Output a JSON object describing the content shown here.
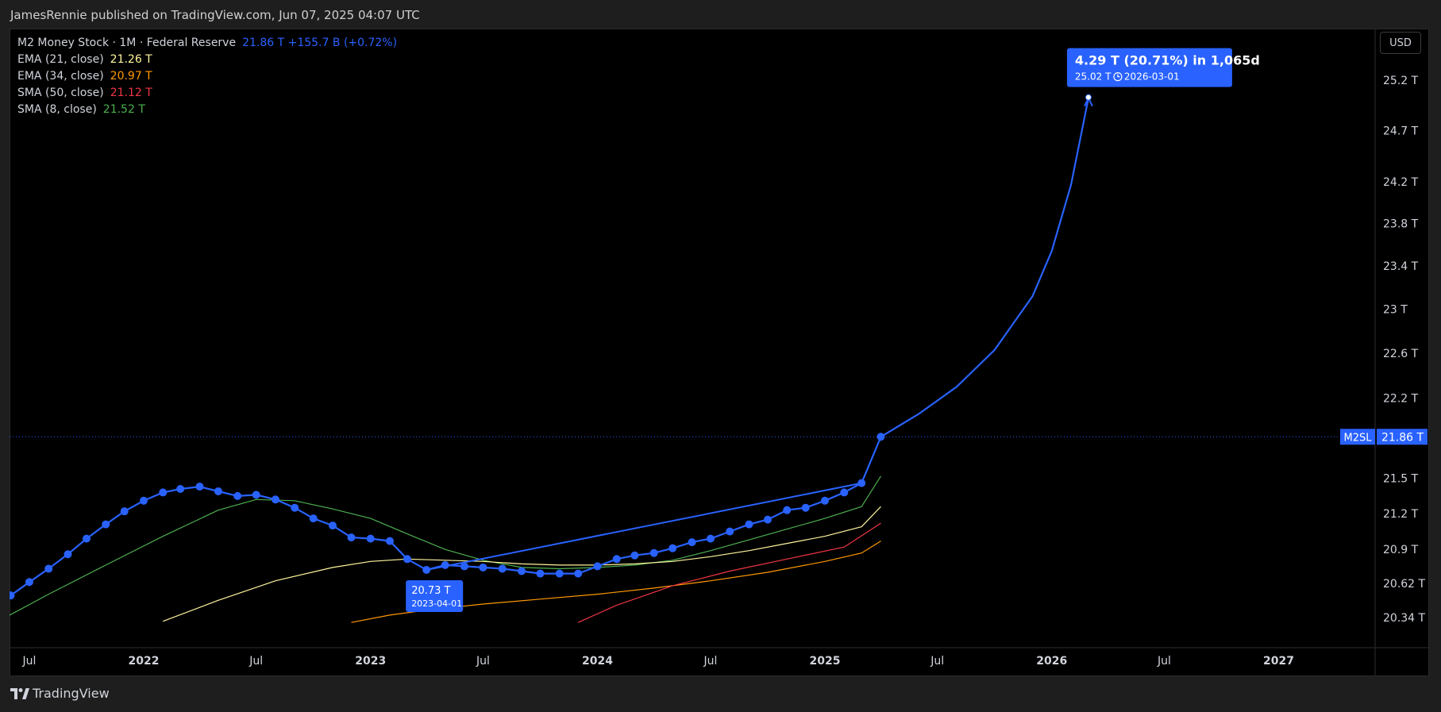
{
  "header": {
    "published": "JamesRennie published on TradingView.com, Jun 07, 2025 04:07 UTC"
  },
  "legend": [
    {
      "name": "M2 Money Stock · 1M · Federal Reserve",
      "value": "21.86 T  +155.7 B  (+0.72%)",
      "color": "#2962ff"
    },
    {
      "name": "EMA (21, close)",
      "value": "21.26 T",
      "color": "#fff59d"
    },
    {
      "name": "EMA (34, close)",
      "value": "20.97 T",
      "color": "#ff9800"
    },
    {
      "name": "SMA (50, close)",
      "value": "21.12 T",
      "color": "#f23645"
    },
    {
      "name": "SMA (8, close)",
      "value": "21.52 T",
      "color": "#4caf50"
    }
  ],
  "currency_button": "USD",
  "footer": {
    "brand": "TradingView"
  },
  "chart_data": {
    "type": "line",
    "y_scale": "log",
    "y_ticks": [
      {
        "value": 25.2,
        "label": "25.2 T"
      },
      {
        "value": 24.7,
        "label": "24.7 T"
      },
      {
        "value": 24.2,
        "label": "24.2 T"
      },
      {
        "value": 23.8,
        "label": "23.8 T"
      },
      {
        "value": 23.4,
        "label": "23.4 T"
      },
      {
        "value": 23.0,
        "label": "23 T"
      },
      {
        "value": 22.6,
        "label": "22.6 T"
      },
      {
        "value": 22.2,
        "label": "22.2 T"
      },
      {
        "value": 21.5,
        "label": "21.5 T"
      },
      {
        "value": 21.2,
        "label": "21.2 T"
      },
      {
        "value": 20.9,
        "label": "20.9 T"
      },
      {
        "value": 20.62,
        "label": "20.62 T"
      },
      {
        "value": 20.34,
        "label": "20.34 T"
      }
    ],
    "x_ticks": [
      {
        "date": "2021-07-01",
        "label": "Jul",
        "bold": false
      },
      {
        "date": "2022-01-01",
        "label": "2022",
        "bold": true
      },
      {
        "date": "2022-07-01",
        "label": "Jul",
        "bold": false
      },
      {
        "date": "2023-01-01",
        "label": "2023",
        "bold": true
      },
      {
        "date": "2023-07-01",
        "label": "Jul",
        "bold": false
      },
      {
        "date": "2024-01-01",
        "label": "2024",
        "bold": true
      },
      {
        "date": "2024-07-01",
        "label": "Jul",
        "bold": false
      },
      {
        "date": "2025-01-01",
        "label": "2025",
        "bold": true
      },
      {
        "date": "2025-07-01",
        "label": "Jul",
        "bold": false
      },
      {
        "date": "2026-01-01",
        "label": "2026",
        "bold": true
      },
      {
        "date": "2026-07-01",
        "label": "Jul",
        "bold": false
      },
      {
        "date": "2027-01-01",
        "label": "2027",
        "bold": true
      }
    ],
    "price_marker": {
      "symbol": "M2SL",
      "value": 21.86,
      "label": "21.86 T"
    },
    "series": [
      {
        "name": "M2 Money Stock",
        "color": "#2962ff",
        "markers": true,
        "points": [
          [
            "2021-05-01",
            20.42
          ],
          [
            "2021-06-01",
            20.52
          ],
          [
            "2021-07-01",
            20.63
          ],
          [
            "2021-08-01",
            20.74
          ],
          [
            "2021-09-01",
            20.86
          ],
          [
            "2021-10-01",
            20.99
          ],
          [
            "2021-11-01",
            21.11
          ],
          [
            "2021-12-01",
            21.22
          ],
          [
            "2022-01-01",
            21.31
          ],
          [
            "2022-02-01",
            21.38
          ],
          [
            "2022-03-01",
            21.41
          ],
          [
            "2022-04-01",
            21.43
          ],
          [
            "2022-05-01",
            21.39
          ],
          [
            "2022-06-01",
            21.35
          ],
          [
            "2022-07-01",
            21.36
          ],
          [
            "2022-08-01",
            21.32
          ],
          [
            "2022-09-01",
            21.25
          ],
          [
            "2022-10-01",
            21.16
          ],
          [
            "2022-11-01",
            21.1
          ],
          [
            "2022-12-01",
            21.0
          ],
          [
            "2023-01-01",
            20.99
          ],
          [
            "2023-02-01",
            20.97
          ],
          [
            "2023-03-01",
            20.82
          ],
          [
            "2023-04-01",
            20.73
          ],
          [
            "2023-05-01",
            20.77
          ],
          [
            "2023-06-01",
            20.76
          ],
          [
            "2023-07-01",
            20.75
          ],
          [
            "2023-08-01",
            20.74
          ],
          [
            "2023-09-01",
            20.72
          ],
          [
            "2023-10-01",
            20.7
          ],
          [
            "2023-11-01",
            20.7
          ],
          [
            "2023-12-01",
            20.7
          ],
          [
            "2024-01-01",
            20.76
          ],
          [
            "2024-02-01",
            20.82
          ],
          [
            "2024-03-01",
            20.85
          ],
          [
            "2024-04-01",
            20.87
          ],
          [
            "2024-05-01",
            20.91
          ],
          [
            "2024-06-01",
            20.96
          ],
          [
            "2024-07-01",
            20.99
          ],
          [
            "2024-08-01",
            21.05
          ],
          [
            "2024-09-01",
            21.11
          ],
          [
            "2024-10-01",
            21.15
          ],
          [
            "2024-11-01",
            21.23
          ],
          [
            "2024-12-01",
            21.25
          ],
          [
            "2025-01-01",
            21.31
          ],
          [
            "2025-02-01",
            21.38
          ],
          [
            "2025-03-01",
            21.46
          ],
          [
            "2025-04-01",
            21.86
          ]
        ]
      },
      {
        "name": "SMA (8, close)",
        "color": "#4caf50",
        "points": [
          [
            "2021-05-01",
            20.28
          ],
          [
            "2021-08-01",
            20.53
          ],
          [
            "2021-11-01",
            20.77
          ],
          [
            "2022-02-01",
            21.01
          ],
          [
            "2022-05-01",
            21.23
          ],
          [
            "2022-07-01",
            21.32
          ],
          [
            "2022-09-01",
            21.31
          ],
          [
            "2022-11-01",
            21.24
          ],
          [
            "2023-01-01",
            21.16
          ],
          [
            "2023-03-01",
            21.03
          ],
          [
            "2023-05-01",
            20.9
          ],
          [
            "2023-07-01",
            20.81
          ],
          [
            "2023-09-01",
            20.75
          ],
          [
            "2023-11-01",
            20.74
          ],
          [
            "2024-01-01",
            20.75
          ],
          [
            "2024-03-01",
            20.77
          ],
          [
            "2024-05-01",
            20.81
          ],
          [
            "2024-07-01",
            20.89
          ],
          [
            "2024-09-01",
            20.98
          ],
          [
            "2024-11-01",
            21.07
          ],
          [
            "2025-01-01",
            21.16
          ],
          [
            "2025-03-01",
            21.26
          ],
          [
            "2025-04-01",
            21.52
          ]
        ]
      },
      {
        "name": "EMA (21, close)",
        "color": "#fff59d",
        "points": [
          [
            "2022-02-01",
            20.31
          ],
          [
            "2022-05-01",
            20.48
          ],
          [
            "2022-08-01",
            20.64
          ],
          [
            "2022-11-01",
            20.75
          ],
          [
            "2023-01-01",
            20.8
          ],
          [
            "2023-03-01",
            20.82
          ],
          [
            "2023-05-01",
            20.81
          ],
          [
            "2023-07-01",
            20.8
          ],
          [
            "2023-09-01",
            20.78
          ],
          [
            "2023-11-01",
            20.77
          ],
          [
            "2024-01-01",
            20.77
          ],
          [
            "2024-03-01",
            20.78
          ],
          [
            "2024-05-01",
            20.8
          ],
          [
            "2024-07-01",
            20.84
          ],
          [
            "2024-09-01",
            20.89
          ],
          [
            "2024-11-01",
            20.95
          ],
          [
            "2025-01-01",
            21.01
          ],
          [
            "2025-03-01",
            21.09
          ],
          [
            "2025-04-01",
            21.26
          ]
        ]
      },
      {
        "name": "EMA (34, close)",
        "color": "#ff9800",
        "points": [
          [
            "2022-12-01",
            20.3
          ],
          [
            "2023-02-01",
            20.36
          ],
          [
            "2023-04-01",
            20.4
          ],
          [
            "2023-07-01",
            20.45
          ],
          [
            "2023-10-01",
            20.49
          ],
          [
            "2024-01-01",
            20.53
          ],
          [
            "2024-04-01",
            20.58
          ],
          [
            "2024-07-01",
            20.64
          ],
          [
            "2024-10-01",
            20.71
          ],
          [
            "2025-01-01",
            20.8
          ],
          [
            "2025-03-01",
            20.87
          ],
          [
            "2025-04-01",
            20.97
          ]
        ]
      },
      {
        "name": "SMA (50, close)",
        "color": "#f23645",
        "points": [
          [
            "2023-12-01",
            20.3
          ],
          [
            "2024-02-01",
            20.44
          ],
          [
            "2024-05-01",
            20.6
          ],
          [
            "2024-08-01",
            20.72
          ],
          [
            "2024-11-01",
            20.82
          ],
          [
            "2025-02-01",
            20.92
          ],
          [
            "2025-04-01",
            21.12
          ]
        ]
      }
    ],
    "projection": {
      "color": "#2962ff",
      "points": [
        [
          "2025-04-01",
          21.86
        ],
        [
          "2025-06-01",
          22.06
        ],
        [
          "2025-08-01",
          22.3
        ],
        [
          "2025-10-01",
          22.63
        ],
        [
          "2025-12-01",
          23.12
        ],
        [
          "2026-01-01",
          23.54
        ],
        [
          "2026-02-01",
          24.17
        ],
        [
          "2026-03-01",
          25.02
        ]
      ]
    },
    "annotations": [
      {
        "date": "2023-04-01",
        "value": 20.73,
        "line1": "20.73 T",
        "line2": "2023-04-01"
      },
      {
        "date": "2026-03-01",
        "value": 25.02,
        "line1": "4.29 T (20.71%) in 1,065d",
        "line2": "25.02 T",
        "line3": "2026-03-01"
      }
    ]
  }
}
